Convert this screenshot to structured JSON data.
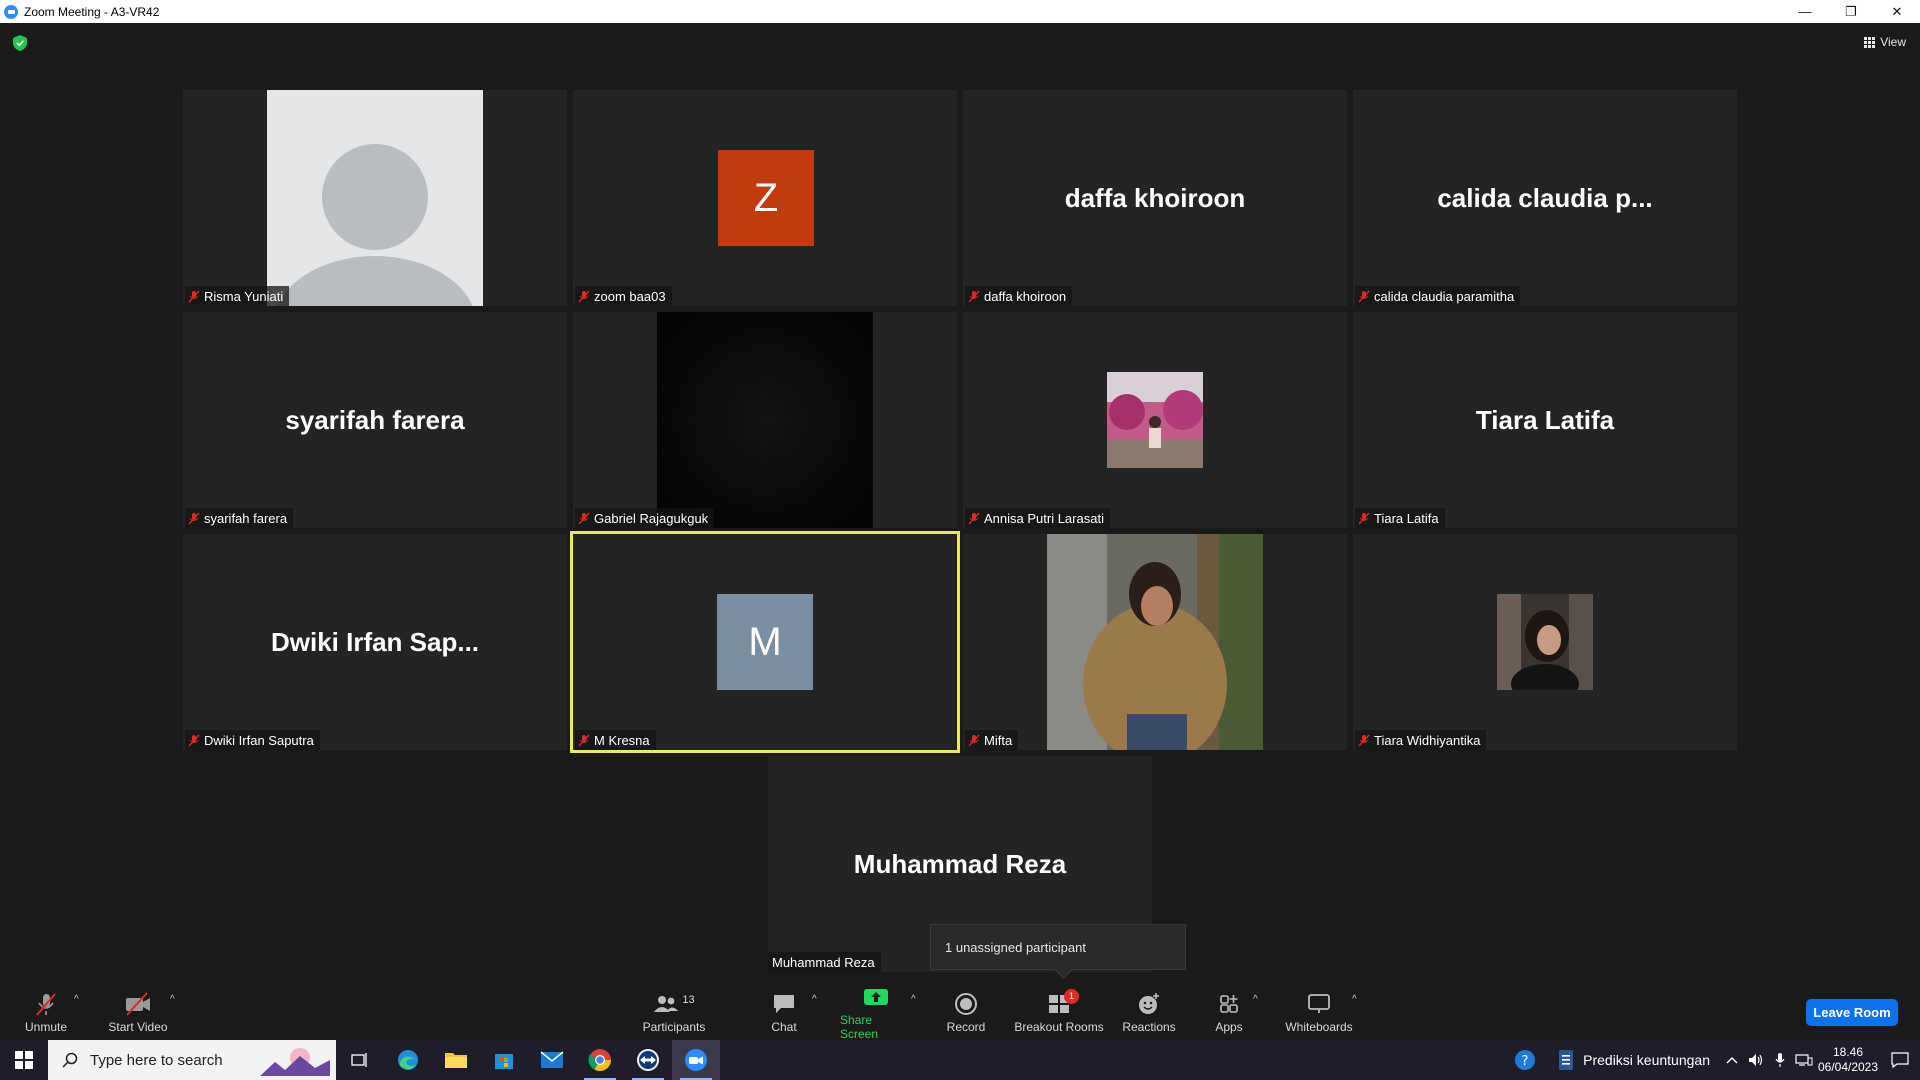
{
  "window": {
    "title": "Zoom Meeting - A3-VR42",
    "minimize": "—",
    "restore": "❐",
    "close": "✕"
  },
  "header": {
    "view_label": "View"
  },
  "tiles": [
    {
      "name": "Risma Yuniati",
      "type": "default-avatar"
    },
    {
      "name": "zoom baa03",
      "type": "initial",
      "initial": "Z",
      "color": "#c23b0e"
    },
    {
      "name": "daffa khoiroon",
      "type": "text",
      "display": "daffa khoiroon"
    },
    {
      "name": "calida claudia paramitha",
      "type": "text",
      "display": "calida claudia p..."
    },
    {
      "name": "syarifah farera",
      "type": "text",
      "display": "syarifah farera"
    },
    {
      "name": "Gabriel Rajagukguk",
      "type": "video-dark"
    },
    {
      "name": "Annisa Putri Larasati",
      "type": "photo"
    },
    {
      "name": "Tiara Latifa",
      "type": "text",
      "display": "Tiara Latifa"
    },
    {
      "name": "Dwiki Irfan Saputra",
      "type": "text",
      "display": "Dwiki Irfan Sap..."
    },
    {
      "name": "M Kresna",
      "type": "initial",
      "initial": "M",
      "color": "#7b8fa0"
    },
    {
      "name": "Mifta",
      "type": "video"
    },
    {
      "name": "Tiara Widhiyantika",
      "type": "photo"
    },
    {
      "name": "Muhammad Reza",
      "type": "text",
      "display": "Muhammad Reza"
    }
  ],
  "tooltip": {
    "text": "1 unassigned participant"
  },
  "toolbar": {
    "unmute": "Unmute",
    "start_video": "Start Video",
    "participants": "Participants",
    "participants_count": "13",
    "chat": "Chat",
    "share_screen": "Share Screen",
    "record": "Record",
    "breakout_rooms": "Breakout Rooms",
    "breakout_badge": "1",
    "reactions": "Reactions",
    "apps": "Apps",
    "whiteboards": "Whiteboards",
    "leave_room": "Leave Room",
    "caret": "^"
  },
  "taskbar": {
    "search_placeholder": "Type here to search",
    "document": "Prediksi keuntungan",
    "time": "18.46",
    "date": "06/04/2023"
  },
  "colors": {
    "active_speaker": "#e8ec58",
    "share_green": "#23d959",
    "leave_blue": "#0e72ed",
    "mute_red": "#e02828"
  }
}
